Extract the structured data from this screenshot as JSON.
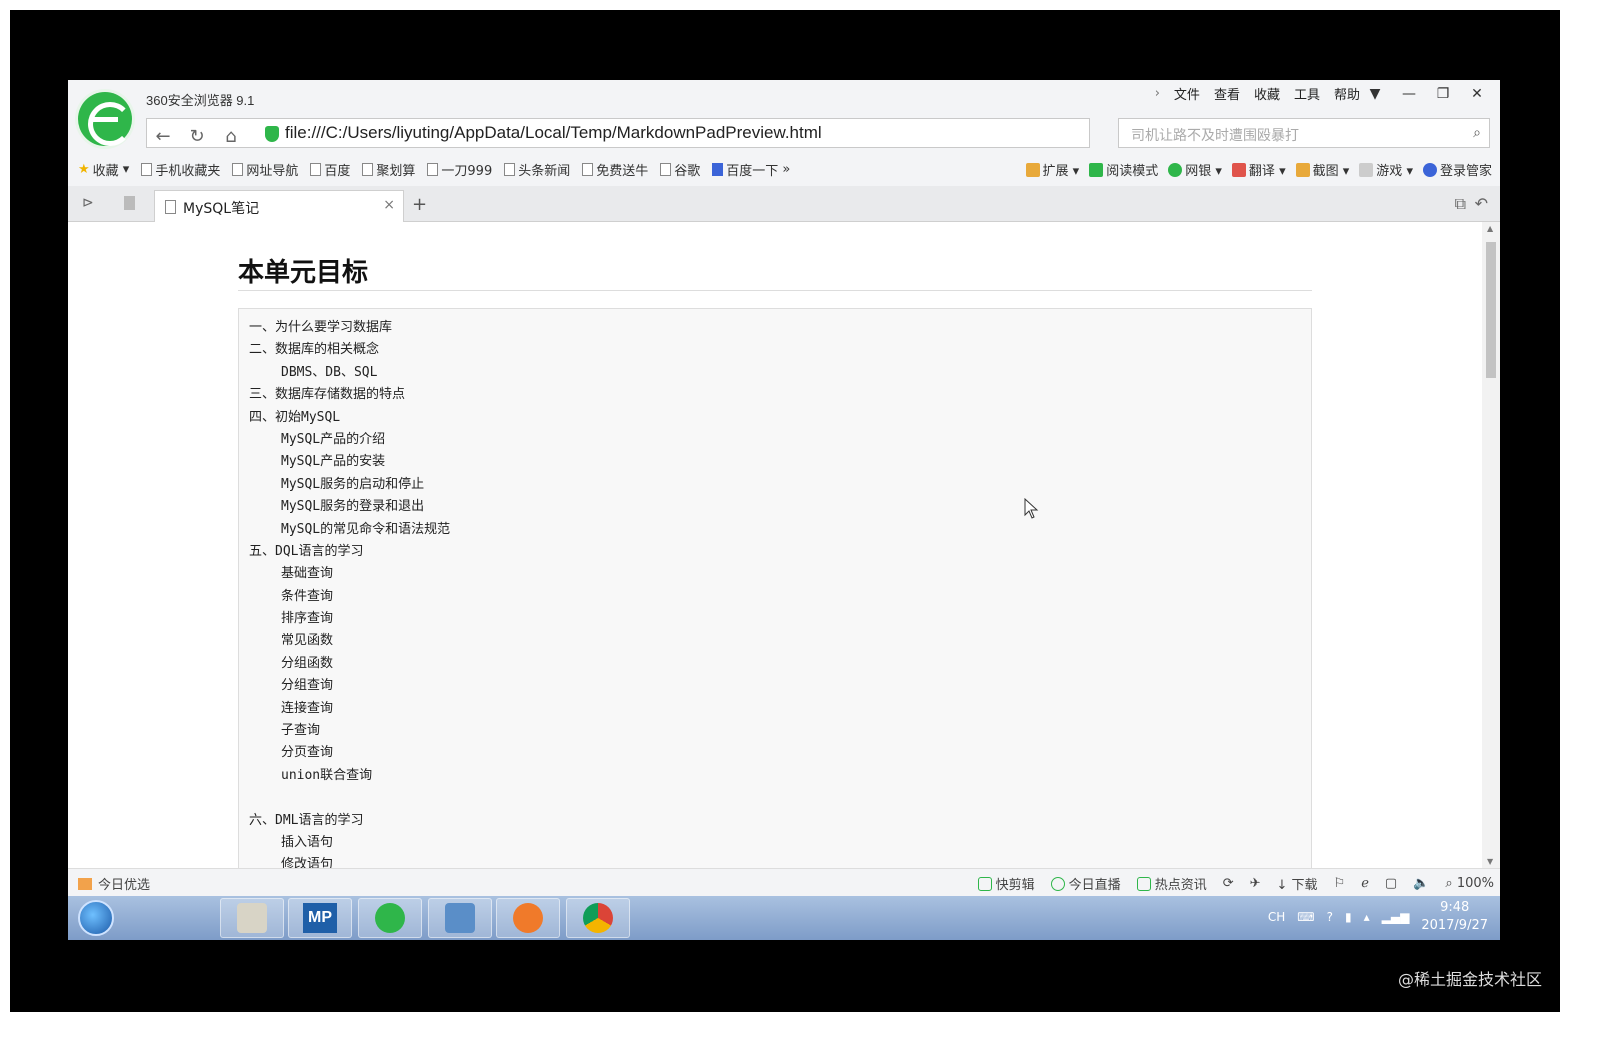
{
  "browser": {
    "app_title": "360安全浏览器 9.1",
    "menus": [
      "文件",
      "查看",
      "收藏",
      "工具",
      "帮助"
    ],
    "url": "file:///C:/Users/liyuting/AppData/Local/Temp/MarkdownPadPreview.html",
    "search_placeholder": "司机让路不及时遭围殴暴打",
    "bookmarks": [
      "收藏",
      "手机收藏夹",
      "网址导航",
      "百度",
      "聚划算",
      "一刀999",
      "头条新闻",
      "免费送牛",
      "谷歌",
      "百度一下"
    ],
    "bookmarks_right": [
      "扩展",
      "阅读模式",
      "网银",
      "翻译",
      "截图",
      "游戏",
      "登录管家"
    ],
    "tab_title": "MySQL笔记"
  },
  "document": {
    "heading": "本单元目标",
    "outline": [
      {
        "text": "一、为什么要学习数据库",
        "level": 0
      },
      {
        "text": "二、数据库的相关概念",
        "level": 0
      },
      {
        "text": "DBMS、DB、SQL",
        "level": 1
      },
      {
        "text": "三、数据库存储数据的特点",
        "level": 0
      },
      {
        "text": "四、初始MySQL",
        "level": 0
      },
      {
        "text": "MySQL产品的介绍",
        "level": 1
      },
      {
        "text": "MySQL产品的安装",
        "level": 1
      },
      {
        "text": "MySQL服务的启动和停止",
        "level": 1
      },
      {
        "text": "MySQL服务的登录和退出",
        "level": 1
      },
      {
        "text": "MySQL的常见命令和语法规范",
        "level": 1
      },
      {
        "text": "五、DQL语言的学习",
        "level": 0
      },
      {
        "text": "基础查询",
        "level": 1
      },
      {
        "text": "条件查询",
        "level": 1
      },
      {
        "text": "排序查询",
        "level": 1
      },
      {
        "text": "常见函数",
        "level": 1
      },
      {
        "text": "分组函数",
        "level": 1
      },
      {
        "text": "分组查询",
        "level": 1
      },
      {
        "text": "连接查询",
        "level": 1
      },
      {
        "text": "子查询",
        "level": 1
      },
      {
        "text": "分页查询",
        "level": 1
      },
      {
        "text": "union联合查询",
        "level": 1
      },
      {
        "text": "",
        "level": -1
      },
      {
        "text": "六、DML语言的学习",
        "level": 0
      },
      {
        "text": "插入语句",
        "level": 1
      },
      {
        "text": "修改语句",
        "level": 1
      }
    ]
  },
  "statusbar": {
    "left_label": "今日优选",
    "right_items": [
      "快剪辑",
      "今日直播",
      "热点资讯",
      "下载",
      "100%"
    ]
  },
  "taskbar": {
    "mp_label": "MP",
    "tray_lang": "CH",
    "clock_time": "9:48",
    "clock_date": "2017/9/27"
  },
  "overlay": {
    "watermark": "@稀土掘金技术社区"
  }
}
